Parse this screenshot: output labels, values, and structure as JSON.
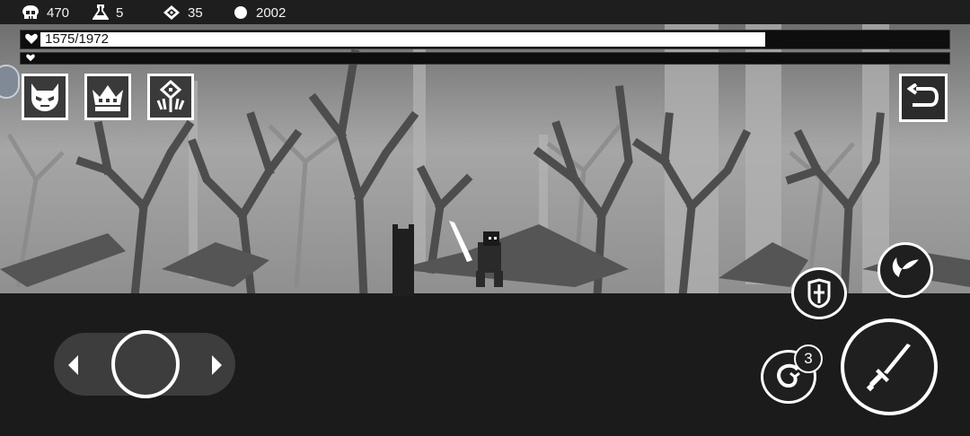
{
  "resources": {
    "skulls": "470",
    "potions": "5",
    "gems": "35",
    "coins": "2002"
  },
  "hp": {
    "text": "1575/1972",
    "current": 1575,
    "max": 1972
  },
  "skills": [
    {
      "icon": "demon-mask-icon"
    },
    {
      "icon": "crown-icon"
    },
    {
      "icon": "rune-emblem-icon"
    }
  ],
  "actions": {
    "dash_charges": "3"
  },
  "colors": {
    "ground": "#1b1b1b",
    "hud_white": "#ffffff",
    "sky": "#9a9a9a"
  }
}
